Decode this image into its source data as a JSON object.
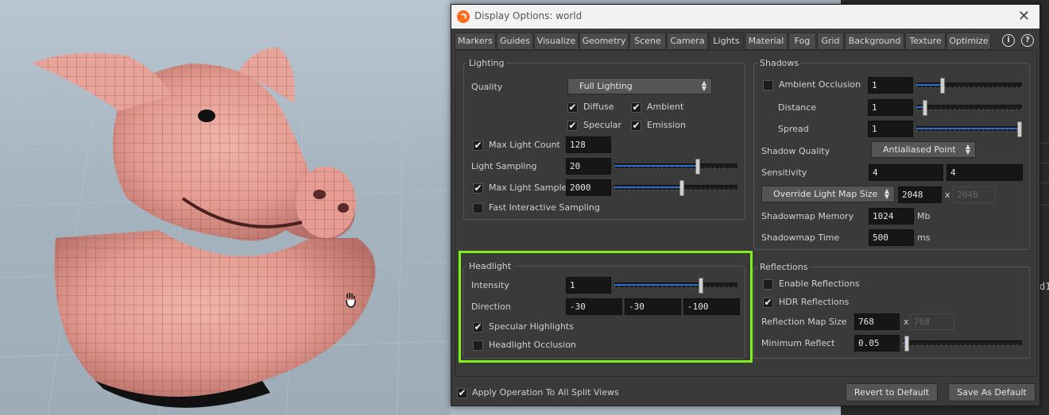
{
  "window": {
    "title": "Display Options:  world",
    "close_icon": "close-icon"
  },
  "tabs": [
    "Markers",
    "Guides",
    "Visualize",
    "Geometry",
    "Scene",
    "Camera",
    "Lights",
    "Material",
    "Fog",
    "Grid",
    "Background",
    "Texture",
    "Optimize"
  ],
  "active_tab": "Lights",
  "lighting": {
    "title": "Lighting",
    "quality_label": "Quality",
    "quality_value": "Full Lighting",
    "diffuse": "Diffuse",
    "ambient": "Ambient",
    "specular": "Specular",
    "emission": "Emission",
    "max_light_count_label": "Max Light Count",
    "max_light_count": "128",
    "light_sampling_label": "Light Sampling",
    "light_sampling": "20",
    "light_sampling_level": 0.68,
    "max_light_samples_label": "Max Light Samples",
    "max_light_samples": "2000",
    "max_light_samples_level": 0.55,
    "fast_interactive_label": "Fast Interactive Sampling"
  },
  "headlight": {
    "title": "Headlight",
    "intensity_label": "Intensity",
    "intensity": "1",
    "intensity_level": 0.7,
    "direction_label": "Direction",
    "direction_x": "-30",
    "direction_y": "-30",
    "direction_z": "-100",
    "specular_highlights_label": "Specular Highlights",
    "headlight_occlusion_label": "Headlight Occlusion"
  },
  "shadows": {
    "title": "Shadows",
    "ambient_occlusion_label": "Ambient Occlusion",
    "ambient_occlusion": "1",
    "ambient_occlusion_level": 0.25,
    "distance_label": "Distance",
    "distance": "1",
    "distance_level": 0.08,
    "spread_label": "Spread",
    "spread": "1",
    "spread_level": 1.0,
    "shadow_quality_label": "Shadow Quality",
    "shadow_quality_value": "Antialiased Point",
    "sensitivity_label": "Sensitivity",
    "sensitivity_a": "4",
    "sensitivity_b": "4",
    "override_button": "Override Light Map Size",
    "map_size_a": "2048",
    "map_size_x": "x",
    "map_size_b": "2048",
    "shadowmap_memory_label": "Shadowmap Memory",
    "shadowmap_memory": "1024",
    "shadowmap_memory_unit": "Mb",
    "shadowmap_time_label": "Shadowmap Time",
    "shadowmap_time": "500",
    "shadowmap_time_unit": "ms"
  },
  "reflections": {
    "title": "Reflections",
    "enable_label": "Enable Reflections",
    "hdr_label": "HDR Reflections",
    "map_size_label": "Reflection Map Size",
    "map_size_a": "768",
    "map_size_x": "x",
    "map_size_b": "768",
    "min_reflect_label": "Minimum Reflect",
    "min_reflect": "0.05",
    "min_reflect_level": 0.03
  },
  "footer": {
    "apply_all_label": "Apply Operation To All Split Views",
    "revert_button": "Revert to Default",
    "save_button": "Save As Default"
  },
  "side_text": "d1",
  "colors": {
    "highlight": "#7ef11a",
    "slider_fill": "#2d6cd0",
    "logo": "#ff6a1a"
  }
}
